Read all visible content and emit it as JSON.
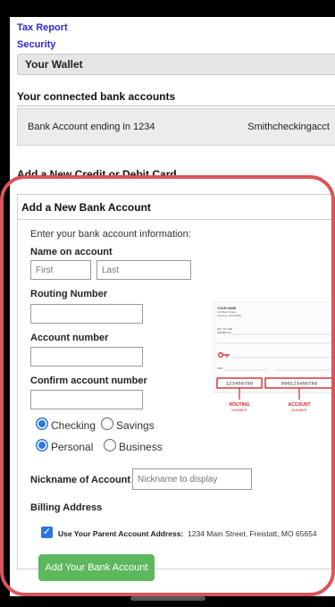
{
  "nav": {
    "tax_report": "Tax Report",
    "security": "Security"
  },
  "wallet": {
    "title": "Your Wallet",
    "connected_title": "Your connected bank accounts",
    "account_row": {
      "label": "Bank Account ending in 1234",
      "nickname": "Smithcheckingacct"
    },
    "add_card_title": "Add a New Credit or Debit Card"
  },
  "bank_form": {
    "title": "Add a New Bank Account",
    "intro": "Enter your bank account information:",
    "name_label": "Name on account",
    "first_placeholder": "First",
    "last_placeholder": "Last",
    "routing_label": "Routing Number",
    "account_label": "Account number",
    "confirm_label": "Confirm account number",
    "type_options": {
      "checking": "Checking",
      "savings": "Savings"
    },
    "type_selected": "Checking",
    "ownership_options": {
      "personal": "Personal",
      "business": "Business"
    },
    "ownership_selected": "Personal",
    "nickname_label": "Nickname of Account",
    "nickname_placeholder": "Nickname to display",
    "billing_label": "Billing Address",
    "use_parent_label": "Use Your Parent Account Address:",
    "parent_address": "1234 Main Street, Freistatt, MO 65654",
    "use_parent_checked": true,
    "submit_label": "Add Your Bank Account"
  },
  "cheque": {
    "routing_digits": "123456789",
    "account_digits": "000123456789",
    "routing_caption_1": "ROUTING",
    "routing_caption_2": "NUMBER",
    "account_caption_1": "ACCOUNT",
    "account_caption_2": "NUMBER",
    "name_line_1": "YOUR NAME",
    "name_line_2": "123 Main Street",
    "name_line_3": "Anytown, ON 00000",
    "pay_line_1": "PAY TO THE",
    "pay_line_2": "ORDER OF",
    "for_label": "FOR"
  },
  "colors": {
    "link": "#2a2ad8",
    "highlight": "#d9555c",
    "accent": "#2b77e0",
    "submit": "#5cb85c",
    "cheque_red": "#d6262c"
  }
}
